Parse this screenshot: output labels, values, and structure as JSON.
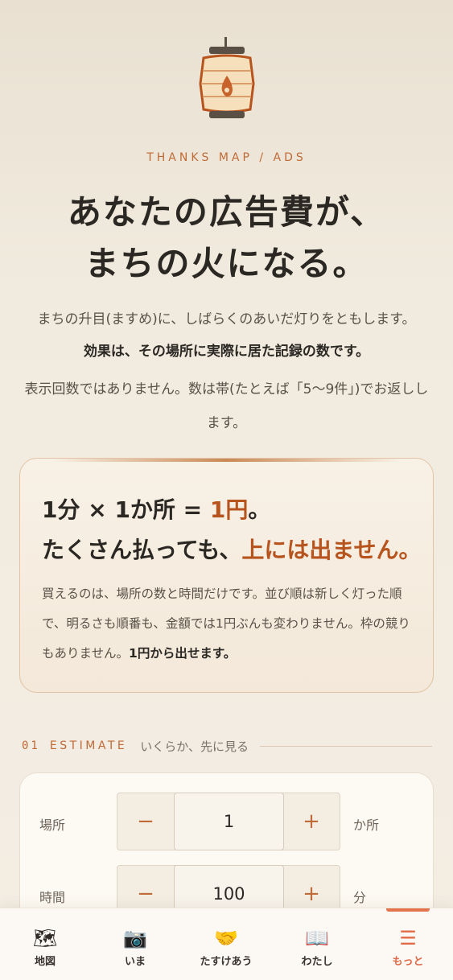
{
  "hero": {
    "eyebrow": "THANKS MAP / ADS",
    "headline_1": "あなたの広告費が、",
    "headline_2": "まちの火になる。",
    "intro_1": "まちの升目(ますめ)に、しばらくのあいだ灯りをともします。",
    "intro_2": "効果は、その場所に実際に居た記録の数です。",
    "intro_3": "表示回数ではありません。数は帯(たとえば「5〜9件」)でお返しします。"
  },
  "pricing_card": {
    "line1_prefix": "1分 × 1か所 = ",
    "line1_price": "1円",
    "line1_suffix": "。",
    "line2_prefix": "たくさん払っても、",
    "line2_accent": "上には出ません。",
    "body": "買えるのは、場所の数と時間だけです。並び順は新しく灯った順で、明るさも順番も、金額では1円ぶんも変わりません。枠の競りもありません。",
    "body_bold": "1円から出せます。"
  },
  "estimate": {
    "section_number": "01",
    "section_title": "ESTIMATE",
    "section_subtitle": "いくらか、先に見る",
    "rows": [
      {
        "label": "場所",
        "value": "1",
        "unit": "か所",
        "minus": "−",
        "plus": "+"
      },
      {
        "label": "時間",
        "value": "100",
        "unit": "分",
        "minus": "−",
        "plus": "+"
      }
    ]
  },
  "tabbar": {
    "items": [
      {
        "label": "地図",
        "icon": "world-map-icon",
        "glyph": "🗺"
      },
      {
        "label": "いま",
        "icon": "camera-icon",
        "glyph": "📷"
      },
      {
        "label": "たすけあう",
        "icon": "handshake-icon",
        "glyph": "🤝"
      },
      {
        "label": "わたし",
        "icon": "book-icon",
        "glyph": "📖"
      },
      {
        "label": "もっと",
        "icon": "menu-icon",
        "glyph": "☰"
      }
    ],
    "active_index": 4
  },
  "colors": {
    "accent": "#b7541e",
    "eyebrow": "#c06a37",
    "active_tab": "#e06a4a"
  }
}
